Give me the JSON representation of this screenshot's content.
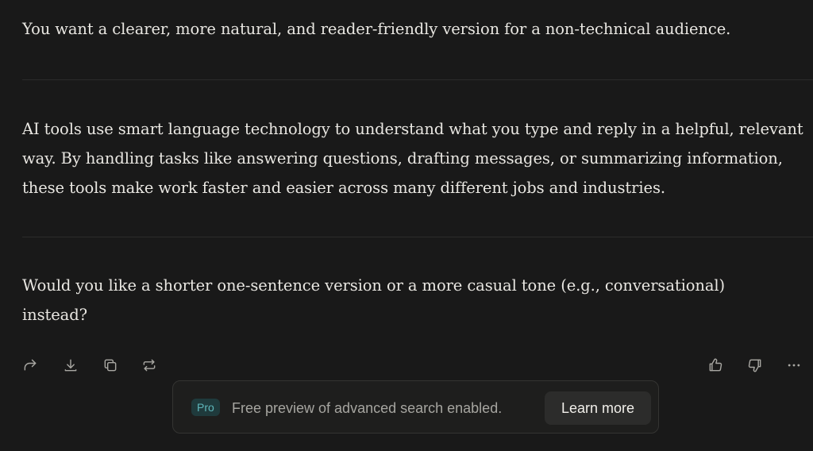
{
  "message": {
    "paragraph_1": "You want a clearer, more natural, and reader-friendly version for a non-technical audience.",
    "paragraph_2": "AI tools use smart language technology to understand what you type and reply in a helpful, relevant way. By handling tasks like answering questions, drafting messages, or summarizing information, these tools make work faster and easier across many different jobs and industries.",
    "paragraph_3": "Would you like a shorter one-sentence version or a more casual tone (e.g., conversational) instead?"
  },
  "actions": {
    "left_icons": [
      "share-icon",
      "download-icon",
      "copy-icon",
      "rewrite-icon"
    ],
    "right_icons": [
      "thumbs-up-icon",
      "thumbs-down-icon",
      "more-icon"
    ]
  },
  "banner": {
    "badge": "Pro",
    "text": "Free preview of advanced search enabled.",
    "button_label": "Learn more",
    "badge_color": "#5fb7bb"
  }
}
